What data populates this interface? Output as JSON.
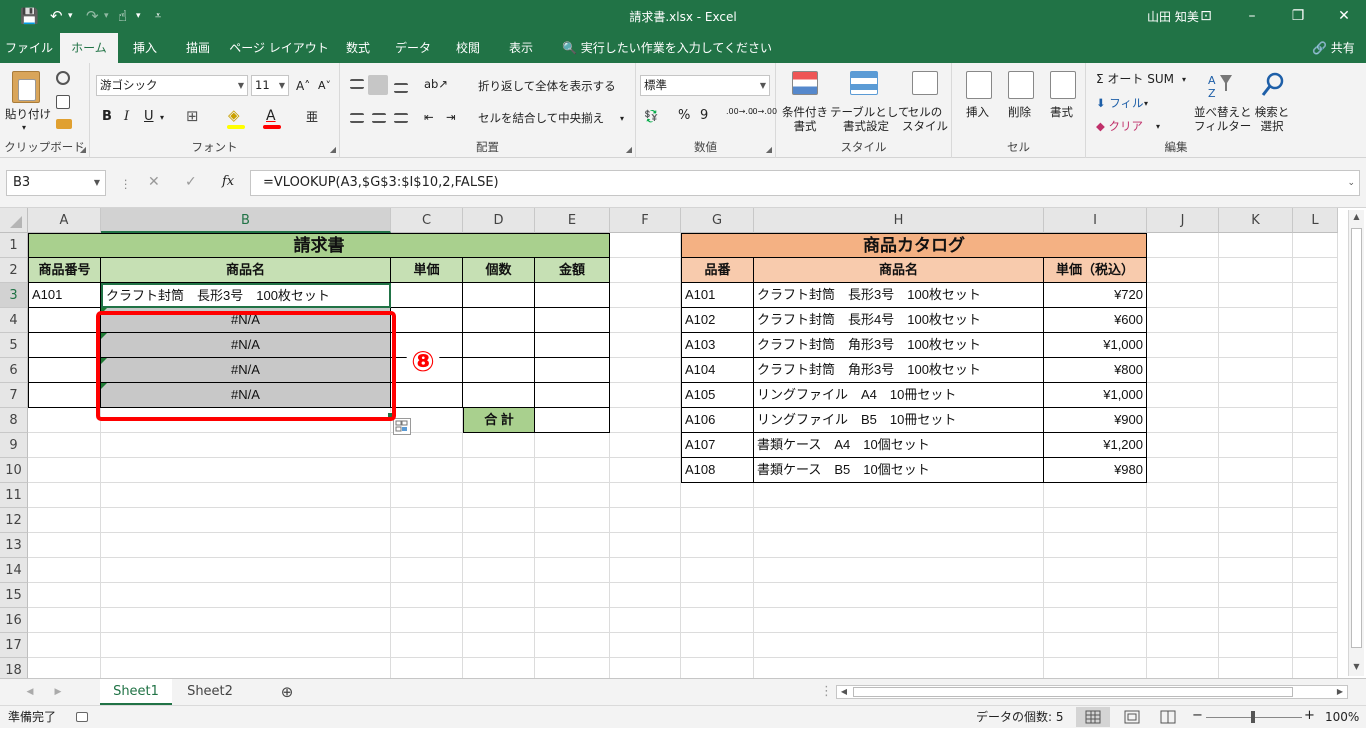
{
  "window": {
    "title": "請求書.xlsx - Excel",
    "user": "山田 知美",
    "controls": {
      "ribbon_opts": "⊡",
      "minimize": "–",
      "restore": "❐",
      "close": "✕"
    },
    "quick_access": {
      "save": "💾",
      "undo": "↶",
      "undo_dd": "▾",
      "redo": "↷",
      "redo_dd": "▾",
      "touch": "☝",
      "touch_dd": "▾",
      "customize": "⩡"
    }
  },
  "tabs": [
    "ファイル",
    "ホーム",
    "挿入",
    "描画",
    "ページ レイアウト",
    "数式",
    "データ",
    "校閲",
    "表示"
  ],
  "active_tab": "ホーム",
  "tell_me": "🔍 実行したい作業を入力してください",
  "share": "🔗 共有",
  "ribbon": {
    "clipboard": {
      "label": "クリップボード",
      "paste": "貼り付け",
      "paste_dd": "▾"
    },
    "font": {
      "label": "フォント",
      "name": "游ゴシック",
      "size": "11",
      "grow": "A˄",
      "shrink": "A˅",
      "bold": "B",
      "italic": "I",
      "underline": "U",
      "underline_dd": "▾",
      "border": "⊞",
      "fill": "◈",
      "color": "A",
      "phonetic": "亜"
    },
    "alignment": {
      "label": "配置",
      "wrap": "折り返して全体を表示する",
      "merge": "セルを結合して中央揃え",
      "merge_dd": "▾",
      "orient": "ab↗",
      "indent_dec": "⇤",
      "indent_inc": "⇥"
    },
    "number": {
      "label": "数値",
      "format": "標準",
      "currency": "💱",
      "percent": "%",
      "comma": "9",
      "inc": ".00→.0",
      "dec": ".0→.00"
    },
    "styles": {
      "label": "スタイル",
      "conditional": "条件付き\n書式",
      "table": "テーブルとして\n書式設定",
      "cell": "セルの\nスタイル"
    },
    "cells": {
      "label": "セル",
      "insert": "挿入",
      "delete": "削除",
      "format": "書式"
    },
    "editing": {
      "label": "編集",
      "autosum": "Σ オート SUM",
      "autosum_dd": "▾",
      "fill": "⬇ フィル",
      "fill_dd": "▾",
      "clear": "◆ クリア",
      "clear_dd": "▾",
      "sort": "並べ替えと\nフィルター",
      "find": "検索と\n選択"
    }
  },
  "formula_bar": {
    "name_box": "B3",
    "cancel": "✕",
    "enter": "✓",
    "fx": "fx",
    "formula": "=VLOOKUP(A3,$G$3:$I$10,2,FALSE)"
  },
  "columns": [
    "A",
    "B",
    "C",
    "D",
    "E",
    "F",
    "G",
    "H",
    "I",
    "J",
    "K",
    "L"
  ],
  "rows": [
    "1",
    "2",
    "3",
    "4",
    "5",
    "6",
    "7",
    "8",
    "9",
    "10",
    "11",
    "12",
    "13",
    "14",
    "15",
    "16",
    "17",
    "18"
  ],
  "invoice": {
    "title": "請求書",
    "headers": [
      "商品番号",
      "商品名",
      "単価",
      "個数",
      "金額"
    ],
    "row3_code": "A101",
    "row3_name": "クラフト封筒　長形3号　100枚セット",
    "na_values": [
      "#N/A",
      "#N/A",
      "#N/A",
      "#N/A"
    ],
    "total_label": "合 計"
  },
  "catalog": {
    "title": "商品カタログ",
    "headers": [
      "品番",
      "商品名",
      "単価（税込）"
    ],
    "items": [
      {
        "code": "A101",
        "name": "クラフト封筒　長形3号　100枚セット",
        "price": "¥720"
      },
      {
        "code": "A102",
        "name": "クラフト封筒　長形4号　100枚セット",
        "price": "¥600"
      },
      {
        "code": "A103",
        "name": "クラフト封筒　角形3号　100枚セット",
        "price": "¥1,000"
      },
      {
        "code": "A104",
        "name": "クラフト封筒　角形3号　100枚セット",
        "price": "¥800"
      },
      {
        "code": "A105",
        "name": "リングファイル　A4　10冊セット",
        "price": "¥1,000"
      },
      {
        "code": "A106",
        "name": "リングファイル　B5　10冊セット",
        "price": "¥900"
      },
      {
        "code": "A107",
        "name": "書類ケース　A4　10個セット",
        "price": "¥1,200"
      },
      {
        "code": "A108",
        "name": "書類ケース　B5　10個セット",
        "price": "¥980"
      }
    ]
  },
  "annotation": "⑧",
  "sheet_tabs": [
    "Sheet1",
    "Sheet2"
  ],
  "add_sheet": "⊕",
  "status": {
    "ready": "準備完了",
    "count": "データの個数: 5",
    "zoom": "100%",
    "zoom_out": "−",
    "zoom_in": "+"
  },
  "colors": {
    "excel_green": "#217346",
    "green_header": "#a9d08e",
    "green_light": "#c6e0b4",
    "orange_header": "#f4b183",
    "orange_light": "#f8cbad",
    "highlight_red": "#ff0000",
    "na_fill": "#c8c8c8"
  }
}
